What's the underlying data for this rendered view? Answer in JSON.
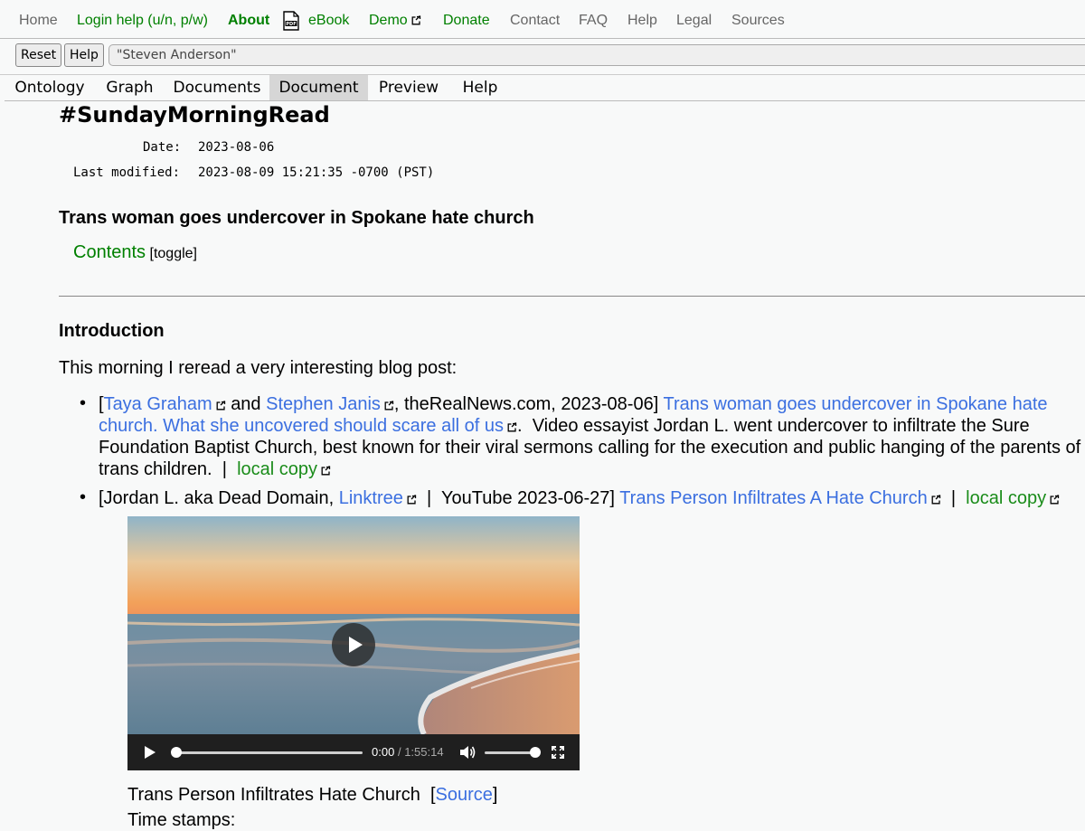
{
  "topnav": {
    "home": "Home",
    "login_help": "Login help (u/n, p/w)",
    "about": "About",
    "ebook": "eBook",
    "demo": "Demo",
    "donate": "Donate",
    "contact": "Contact",
    "faq": "FAQ",
    "help": "Help",
    "legal": "Legal",
    "sources": "Sources"
  },
  "searchbar": {
    "reset_label": "Reset",
    "help_label": "Help",
    "query": "\"Steven Anderson\""
  },
  "tabs": [
    "Ontology",
    "Graph",
    "Documents",
    "Document",
    "Preview",
    "Help"
  ],
  "active_tab": "Document",
  "document": {
    "title": "#SundayMorningRead",
    "date_label": "Date:",
    "date": "2023-08-06",
    "modified_label": "Last modified:",
    "modified": "2023-08-09 15:21:35 -0700 (PST)",
    "subtitle": "Trans woman goes undercover in Spokane hate church",
    "contents_label": "Contents",
    "contents_toggle": "[toggle]",
    "intro_heading": "Introduction",
    "intro_text": "This morning I reread a very interesting blog post:"
  },
  "bullets": [
    {
      "open_bracket": "[",
      "author1": "Taya Graham",
      "and": "and",
      "author2": "Stephen Janis",
      "source": ", theRealNews.com, 2023-08-06]",
      "link_line1": "Trans woman goes undercover in Spokane hate",
      "link_line2": "church. What she uncovered should scare all of us",
      "desc_line1": "Video essayist Jordan L. went undercover to infiltrate the Sure",
      "desc_line2": "Foundation Baptist Church, best known for their viral sermons calling for the execution and public hanging of the parents of",
      "desc_line3": "trans children.",
      "sep": "|",
      "local_copy": "local copy"
    },
    {
      "prefix": "[Jordan L. aka Dead Domain,",
      "linktree": "Linktree",
      "sep": "|",
      "youtube": "YouTube 2023-06-27]",
      "video_link": "Trans Person Infiltrates A Hate Church",
      "local_copy": "local copy"
    }
  ],
  "video": {
    "current_time": "0:00",
    "separator": "/",
    "duration": "1:55:14",
    "progress": 0.0,
    "volume": 1.0,
    "caption": "Trans Person Infiltrates Hate Church",
    "source_label": "Source",
    "timestamps_label": "Time stamps:"
  },
  "colors": {
    "link_blue": "#3b6fe0",
    "nav_green": "#008000",
    "local_copy_green": "#1a8c1a",
    "active_tab_bg": "#d6d6d6"
  },
  "icons": {
    "external_link": "external-link-icon",
    "pdf": "pdf-icon",
    "play": "play-icon",
    "volume": "volume-icon",
    "fullscreen": "fullscreen-icon"
  }
}
